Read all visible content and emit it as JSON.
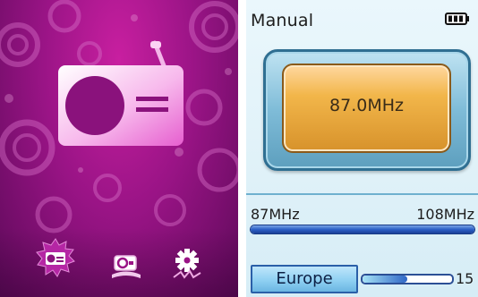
{
  "left_panel": {
    "dock": {
      "items": [
        {
          "name": "radio",
          "icon": "radio-icon",
          "selected": true
        },
        {
          "name": "recorder",
          "icon": "recorder-icon",
          "selected": false
        },
        {
          "name": "settings",
          "icon": "gear-icon",
          "selected": false
        }
      ]
    }
  },
  "right_panel": {
    "mode": "Manual",
    "battery": {
      "icon": "battery-icon",
      "level_fraction": 1.0
    },
    "frequency": "87.0MHz",
    "range": {
      "min": "87MHz",
      "max": "108MHz"
    },
    "region": "Europe",
    "volume": {
      "value": "15",
      "fill_fraction": 0.5
    }
  },
  "colors": {
    "menu_bg": "#9a1486",
    "screen_bg": "#e6f5fb",
    "frequency_box": "#f0b24a",
    "accent_blue": "#2b5fc6"
  }
}
